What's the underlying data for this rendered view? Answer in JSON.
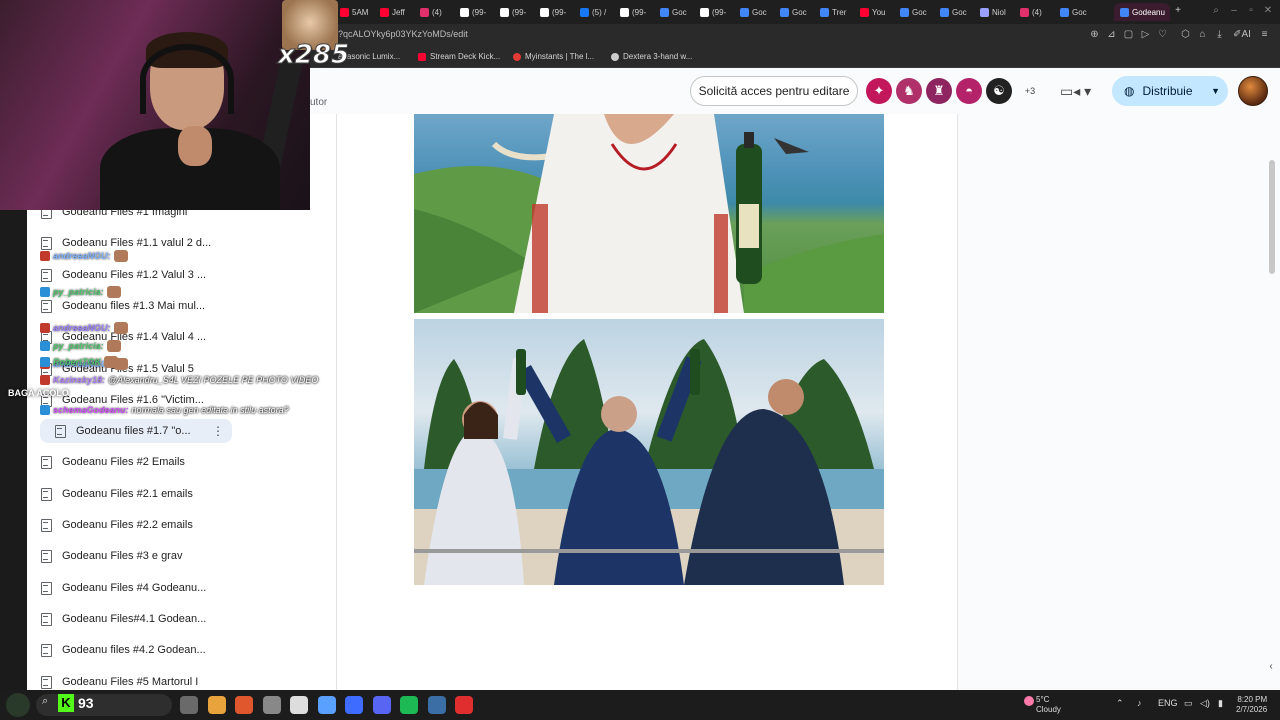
{
  "browser": {
    "tabs": [
      {
        "label": "5AM",
        "color": "#ff0033"
      },
      {
        "label": "Jeff",
        "color": "#ff0033"
      },
      {
        "label": "(4)",
        "color": "#e1306c"
      },
      {
        "label": "(99-",
        "color": "#ffffff"
      },
      {
        "label": "(99-",
        "color": "#ffffff"
      },
      {
        "label": "(99-",
        "color": "#ffffff"
      },
      {
        "label": "(5) /",
        "color": "#1877f2"
      },
      {
        "label": "(99-",
        "color": "#ffffff"
      },
      {
        "label": "Goc",
        "color": "#4285f4"
      },
      {
        "label": "(99-",
        "color": "#ffffff"
      },
      {
        "label": "Goc",
        "color": "#4285f4"
      },
      {
        "label": "Goc",
        "color": "#4285f4"
      },
      {
        "label": "Trer",
        "color": "#4285f4"
      },
      {
        "label": "You",
        "color": "#ff0033"
      },
      {
        "label": "Goc",
        "color": "#4285f4"
      },
      {
        "label": "Goc",
        "color": "#4285f4"
      },
      {
        "label": "Niol",
        "color": "#9aa0ff"
      },
      {
        "label": "(4)",
        "color": "#e1306c"
      },
      {
        "label": "Goc",
        "color": "#4285f4"
      }
    ],
    "active_tab": "Godeanu",
    "new_tab": "+",
    "url": "?qcALOYky6p03YKzYoMDs/edit",
    "bookmarks": [
      {
        "label": "anasonic Lumix...",
        "color": "#888888"
      },
      {
        "label": "Stream Deck Kick...",
        "color": "#ff0033"
      },
      {
        "label": "Myinstants | The l...",
        "color": "#e53935"
      },
      {
        "label": "Dextera 3-hand w...",
        "color": "#cccccc"
      }
    ]
  },
  "docs": {
    "request_edit": "Solicită acces pentru editare",
    "extra_viewers": "+3",
    "share": "Distribuie",
    "tutor_fragment": "utor",
    "viewer_colors": [
      "#c2185b",
      "#b0306a",
      "#8e2460",
      "#b4236a",
      "#222222"
    ]
  },
  "outline": {
    "items": [
      {
        "label": "Godeanu Files #1 Imagini",
        "selected": false
      },
      {
        "label": "Godeanu Files #1.1 valul 2 d...",
        "selected": false
      },
      {
        "label": "Godeanu Files #1.2 Valul 3 ...",
        "selected": false
      },
      {
        "label": "Godeanu files #1.3 Mai mul...",
        "selected": false
      },
      {
        "label": "Godeanu Files #1.4 Valul 4 ...",
        "selected": false
      },
      {
        "label": "Godeanu Files #1.5 Valul 5",
        "selected": false
      },
      {
        "label": "Godeanu Files #1.6 \"Victim...",
        "selected": false
      },
      {
        "label": "Godeanu files #1.7 \"o...",
        "selected": true
      },
      {
        "label": "Godeanu Files #2 Emails",
        "selected": false
      },
      {
        "label": "Godeanu Files #2.1 emails",
        "selected": false
      },
      {
        "label": "Godeanu Files #2.2 emails",
        "selected": false
      },
      {
        "label": "Godeanu Files #3 e grav",
        "selected": false
      },
      {
        "label": "Godeanu Files #4 Godeanu...",
        "selected": false
      },
      {
        "label": "Godeanu Files#4.1 Godean...",
        "selected": false
      },
      {
        "label": "Godeanu files #4.2 Godean...",
        "selected": false
      },
      {
        "label": "Godeanu Files #5 Martorul I",
        "selected": false
      }
    ]
  },
  "stream": {
    "multiplier": "x285",
    "chat": [
      {
        "user": "andreeaNGU:",
        "msg": "",
        "color": "#7fb3ff"
      },
      {
        "user": "py_patricia:",
        "msg": "",
        "color": "#4fc36b"
      },
      {
        "user": "andreeaNGU:",
        "msg": "",
        "color": "#9b7fff"
      },
      {
        "user": "py_patricia:",
        "msg": "",
        "color": "#4fc36b"
      },
      {
        "user": "andreeaNGU:",
        "msg": "",
        "color": "#7fb3ff"
      },
      {
        "user": "RobertTGK",
        "msg": "",
        "color": "#4fc36b"
      },
      {
        "user": "Kazinsky18:",
        "msg": "@Alexandru_S4L VEZI POZELE PE PHOTO VIDEO",
        "color": "#b07fff"
      },
      {
        "user": "schemaGodeanu:",
        "msg": "normala sau gen editata in stilu astora?",
        "color": "#d04fff"
      }
    ],
    "baga": "BAGA ACOLO"
  },
  "taskbar": {
    "viewers": "93",
    "weather_temp": "5°C",
    "weather_desc": "Cloudy",
    "lang": "ENG",
    "time": "8:20 PM",
    "date": "2/7/2026",
    "apps": [
      "#6a6a6a",
      "#e8a33c",
      "#e0572e",
      "#888888",
      "#dddddd",
      "#5aa0ff",
      "#3d6cff",
      "#5865f2",
      "#1db954",
      "#3a6ea5",
      "#e02e2e"
    ]
  },
  "icons": [
    "search-icon",
    "bookmark-icon",
    "extension-icon",
    "heart-icon",
    "download-icon",
    "menu-icon",
    "globe-icon",
    "video-call-icon",
    "doc-icon",
    "more-vert-icon",
    "windows-search-icon"
  ]
}
